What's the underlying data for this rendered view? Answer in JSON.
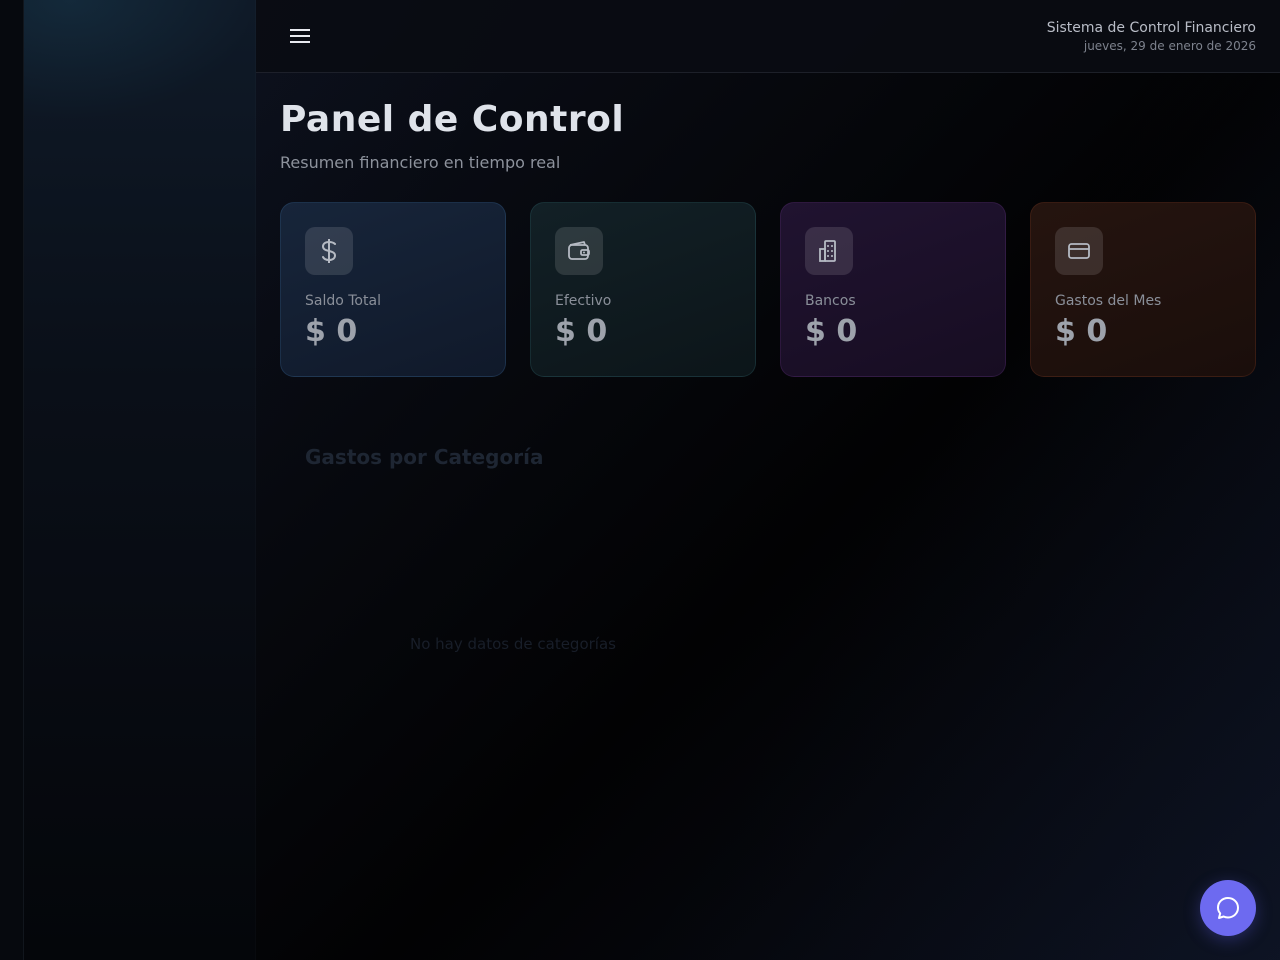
{
  "header": {
    "title": "Sistema de Control Financiero",
    "date": "jueves, 29 de enero de 2026",
    "menu_icon": "menu-icon"
  },
  "main": {
    "title": "Panel de Control",
    "subtitle": "Resumen financiero en tiempo real",
    "cards": [
      {
        "label": "Saldo Total",
        "value": "$ 0",
        "icon": "dollar-icon"
      },
      {
        "label": "Efectivo",
        "value": "$ 0",
        "icon": "wallet-icon"
      },
      {
        "label": "Bancos",
        "value": "$ 0",
        "icon": "building-icon"
      },
      {
        "label": "Gastos del Mes",
        "value": "$ 0",
        "icon": "credit-card-icon"
      }
    ],
    "chart": {
      "title": "Gastos por Categoría",
      "empty_message": "No hay datos de categorías"
    }
  },
  "chat": {
    "icon": "chat-bubble-icon"
  },
  "colors": {
    "accent": "#6d6af0",
    "background": "#050608"
  }
}
